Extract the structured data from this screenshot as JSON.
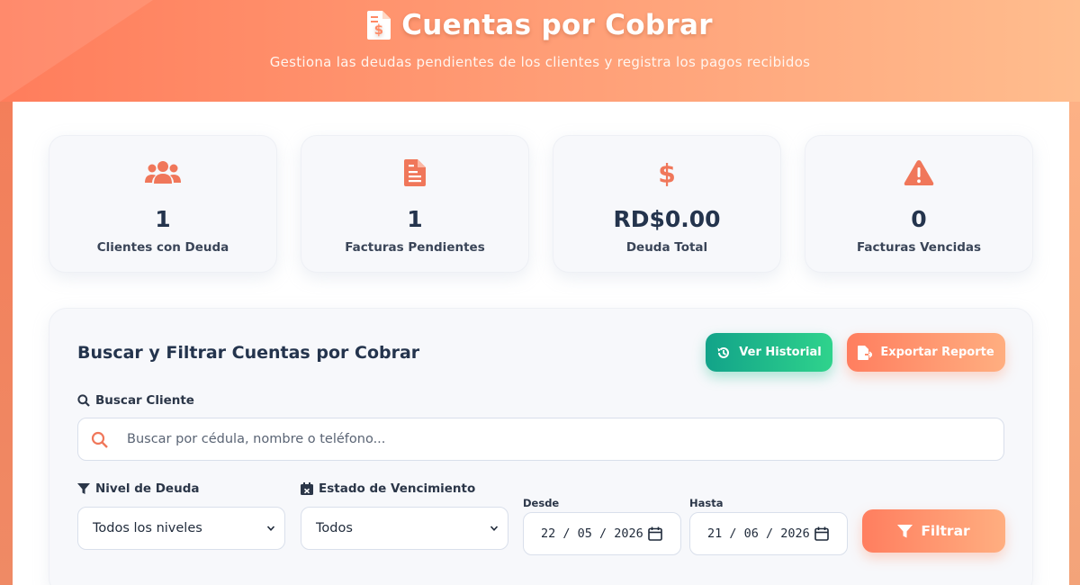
{
  "header": {
    "title": "Cuentas por Cobrar",
    "subtitle": "Gestiona las deudas pendientes de los clientes y registra los pagos recibidos",
    "icon": "invoice-dollar-icon"
  },
  "stats": [
    {
      "icon": "users-icon",
      "value": "1",
      "label": "Clientes con Deuda"
    },
    {
      "icon": "document-icon",
      "value": "1",
      "label": "Facturas Pendientes"
    },
    {
      "icon": "dollar-icon",
      "value": "RD$0.00",
      "label": "Deuda Total"
    },
    {
      "icon": "warning-icon",
      "value": "0",
      "label": "Facturas Vencidas"
    }
  ],
  "filters": {
    "title": "Buscar y Filtrar Cuentas por Cobrar",
    "history_button": "Ver Historial",
    "export_button": "Exportar Reporte",
    "search_label": "Buscar Cliente",
    "search_placeholder": "Buscar por cédula, nombre o teléfono...",
    "debt_level_label": "Nivel de Deuda",
    "debt_level_value": "Todos los niveles",
    "due_status_label": "Estado de Vencimiento",
    "due_status_value": "Todos",
    "from_label": "Desde",
    "from_value": "22 / 05 / 2026",
    "to_label": "Hasta",
    "to_value": "21 / 06 / 2026",
    "filter_button": "Filtrar"
  },
  "colors": {
    "accent": "#ff7e5f",
    "accent_light": "#ffae80",
    "success": "#1db589",
    "text_dark": "#24344d"
  }
}
